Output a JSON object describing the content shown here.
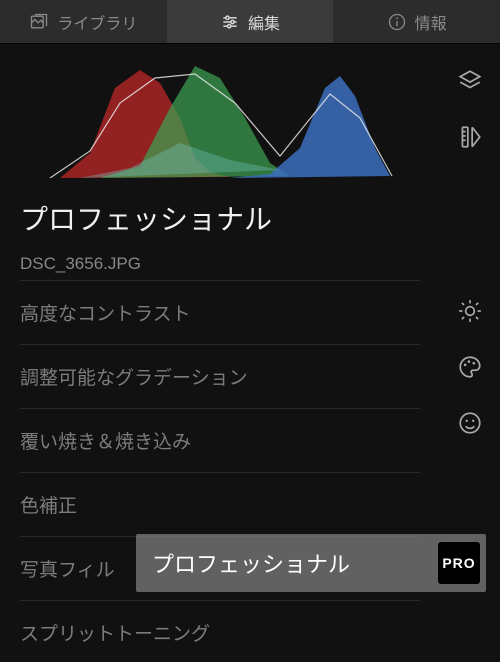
{
  "tabs": {
    "library": "ライブラリ",
    "edit": "編集",
    "info": "情報"
  },
  "section_title": "プロフェッショナル",
  "filename": "DSC_3656.JPG",
  "adjustments": [
    "高度なコントラスト",
    "調整可能なグラデーション",
    "覆い焼き＆焼き込み",
    "色補正",
    "写真フィル",
    "スプリットトーニング"
  ],
  "toast": {
    "label": "プロフェッショナル",
    "badge": "PRO"
  },
  "side_icons": {
    "layers": "layers-icon",
    "ruler": "ruler-icon",
    "exposure": "exposure-icon",
    "color": "color-palette-icon",
    "face": "face-icon"
  }
}
